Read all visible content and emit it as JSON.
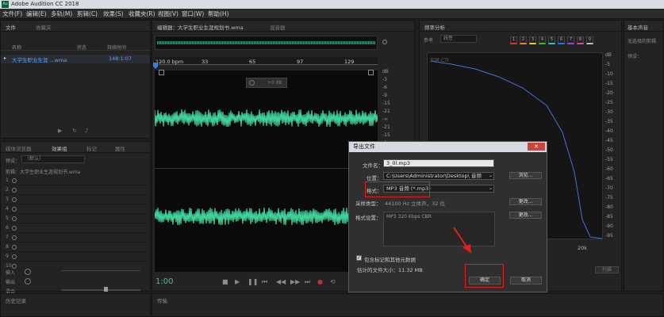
{
  "window": {
    "title": "Adobe Audition CC 2018",
    "app_icon": "Au"
  },
  "menu": [
    "文件(F)",
    "编辑(E)",
    "多轨(M)",
    "剪辑(C)",
    "效果(S)",
    "收藏夹(R)",
    "视图(V)",
    "窗口(W)",
    "帮助(H)"
  ],
  "files_panel": {
    "tabs": [
      "文件",
      "收藏夹"
    ],
    "col_name": "名称",
    "col_status": "状态",
    "col_duration": "持续时间",
    "file_name": "大学生职业生涯 ...wma",
    "file_duration": "148:1:07"
  },
  "mixer_panel": {
    "tabs": [
      "媒体浏览器",
      "效果组",
      "标记",
      "属性"
    ],
    "preset_label": "预设：",
    "preset_value": "（默认）",
    "clip_label": "剪辑：大学生职业生涯规划书.wma",
    "rows": [
      "1",
      "2",
      "3",
      "4",
      "5",
      "6",
      "7",
      "8",
      "9",
      "10"
    ],
    "input_label": "输入",
    "output_label": "输出",
    "mix_label": "混合"
  },
  "editor": {
    "tab": "编辑器：大学生职业生涯规划书.wma",
    "mixer_tab": "混音器",
    "bpm_label": "120.0 bpm",
    "ruler": [
      "33",
      "65",
      "97",
      "129"
    ],
    "hud_value": "+0 dB",
    "db_labels_top": [
      "dB",
      "-3",
      "-6",
      "-9",
      "-15",
      "-21",
      "-∞",
      "-21",
      "-15",
      "-9",
      "-6",
      "-3"
    ],
    "db_labels_bottom": [
      "dB",
      "-3",
      "-6",
      "-9",
      "-15",
      "-21",
      "-∞",
      "-21",
      "-15",
      "-9",
      "-6",
      "-3"
    ],
    "time": "1:00"
  },
  "spectrum": {
    "tab": "频率分析",
    "options_label": "参考",
    "scale_label": "线性",
    "realtime": "实时 CTI",
    "db_labels": [
      "dB",
      "-5",
      "-10",
      "-15",
      "-20",
      "-25",
      "-30",
      "-35",
      "-40",
      "-45",
      "-50",
      "-55",
      "-60",
      "-65",
      "-70",
      "-75",
      "-80",
      "-85",
      "-90",
      "-95"
    ],
    "freq_label": "20k",
    "swatches": [
      "1",
      "2",
      "3",
      "4",
      "5",
      "6",
      "7",
      "8",
      "9"
    ],
    "swatch_colors": [
      "#e03030",
      "#f08020",
      "#f0d020",
      "#30c030",
      "#30c0c0",
      "#3070e0",
      "#a040e0",
      "#e040a0",
      "#c0c0c0"
    ],
    "scan_button": "扫描"
  },
  "right_panel": {
    "tab": "基本声音",
    "preset_label": "预设：",
    "no_selection": "无选择的剪辑"
  },
  "history_panel": {
    "tab": "历史记录"
  },
  "bottom_panel": {
    "tab": "传输"
  },
  "dialog": {
    "title": "导出文件",
    "close": "✕",
    "filename_label": "文件名：",
    "filename_value": "3_0l.mp3",
    "location_label": "位置：",
    "location_value": "C:\\Users\\Administrator\\Desktop\\ 音频",
    "browse": "浏览...",
    "format_label": "格式：",
    "format_value": "MP3 音频 (*.mp3)",
    "sample_label": "采样类型：",
    "sample_value": "44100 Hz 立体声，32 位",
    "change1": "更改...",
    "settings_label": "格式设置：",
    "settings_value": "MP3 320 Kbps CBR",
    "change2": "更改...",
    "include_markers": "包含标记和其他元数据",
    "estimated_size": "估计的文件大小：11.32 MB",
    "ok": "确定",
    "cancel": "取消"
  }
}
